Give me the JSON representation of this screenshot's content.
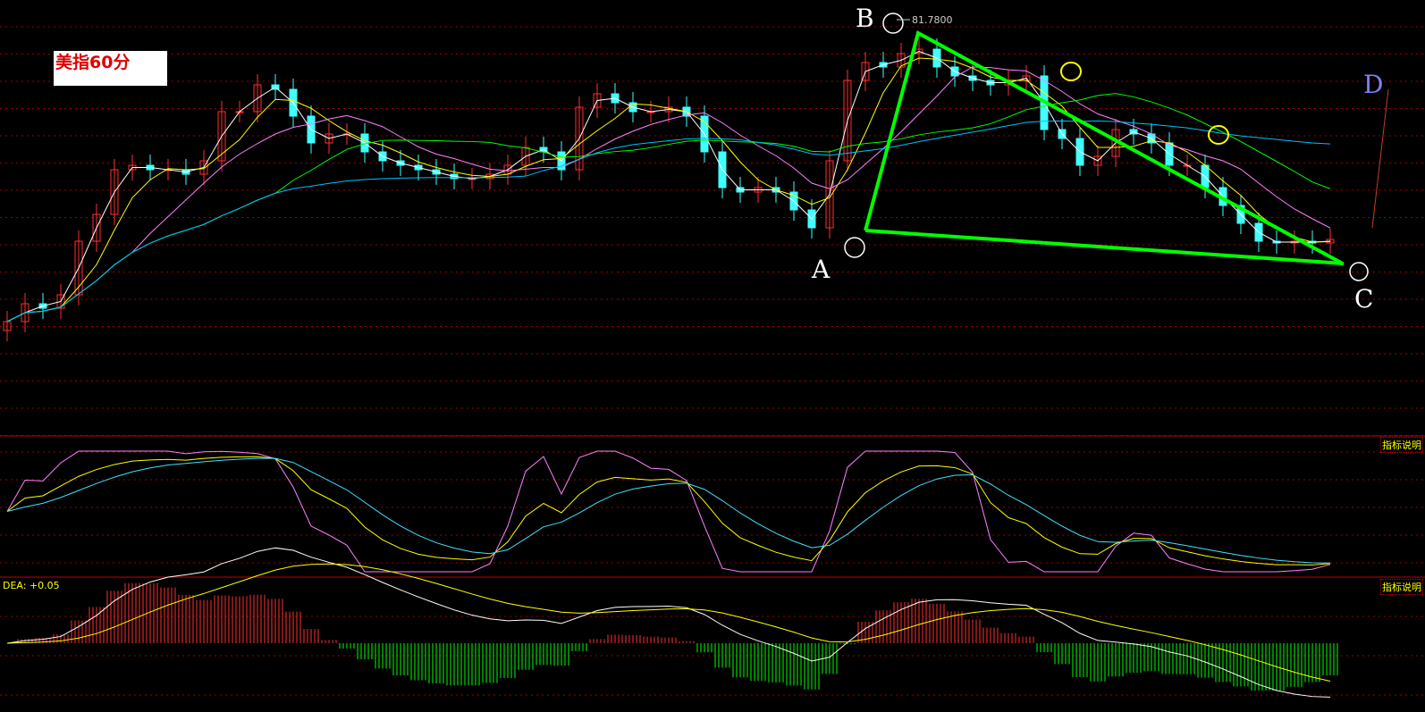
{
  "header": {
    "title": "美指60分",
    "high_marker": "81.7800"
  },
  "annotations": {
    "A": "A",
    "B": "B",
    "C": "C",
    "D": "D"
  },
  "kdj_panel": {
    "label": "指标说明"
  },
  "macd_panel": {
    "label": "指标说明",
    "dea_readout": "DEA: +0.05"
  },
  "colors": {
    "up": "#ff3030",
    "down": "#40ffff",
    "ma1": "#ffffff",
    "ma2": "#ffff00",
    "ma3": "#ff80ff",
    "ma4": "#00ff00",
    "ma5": "#00c0ff",
    "trend": "#00ff00",
    "grid": "#a00000"
  },
  "chart_data": {
    "type": "candlestick",
    "title": "美指60分",
    "high": 81.78,
    "close": [
      78.55,
      78.75,
      78.7,
      78.85,
      79.45,
      79.75,
      80.25,
      80.3,
      80.25,
      80.25,
      80.2,
      80.35,
      80.9,
      80.9,
      81.2,
      81.15,
      80.85,
      80.55,
      80.65,
      80.65,
      80.45,
      80.35,
      80.3,
      80.25,
      80.2,
      80.15,
      80.15,
      80.2,
      80.3,
      80.5,
      80.45,
      80.25,
      80.95,
      81.1,
      81.0,
      80.9,
      80.9,
      80.95,
      80.85,
      80.45,
      80.05,
      80.0,
      80.05,
      80.0,
      79.8,
      79.6,
      80.35,
      81.25,
      81.45,
      81.4,
      81.55,
      81.6,
      81.4,
      81.3,
      81.25,
      81.2,
      81.25,
      81.3,
      80.7,
      80.6,
      80.3,
      80.4,
      80.7,
      80.65,
      80.55,
      80.3,
      80.3,
      80.05,
      79.85,
      79.65,
      79.45,
      79.43,
      79.45,
      79.43,
      79.47
    ],
    "ma_periods": [
      2,
      4,
      8,
      16,
      30
    ],
    "indicators": [
      "KDJ",
      "MACD"
    ]
  }
}
